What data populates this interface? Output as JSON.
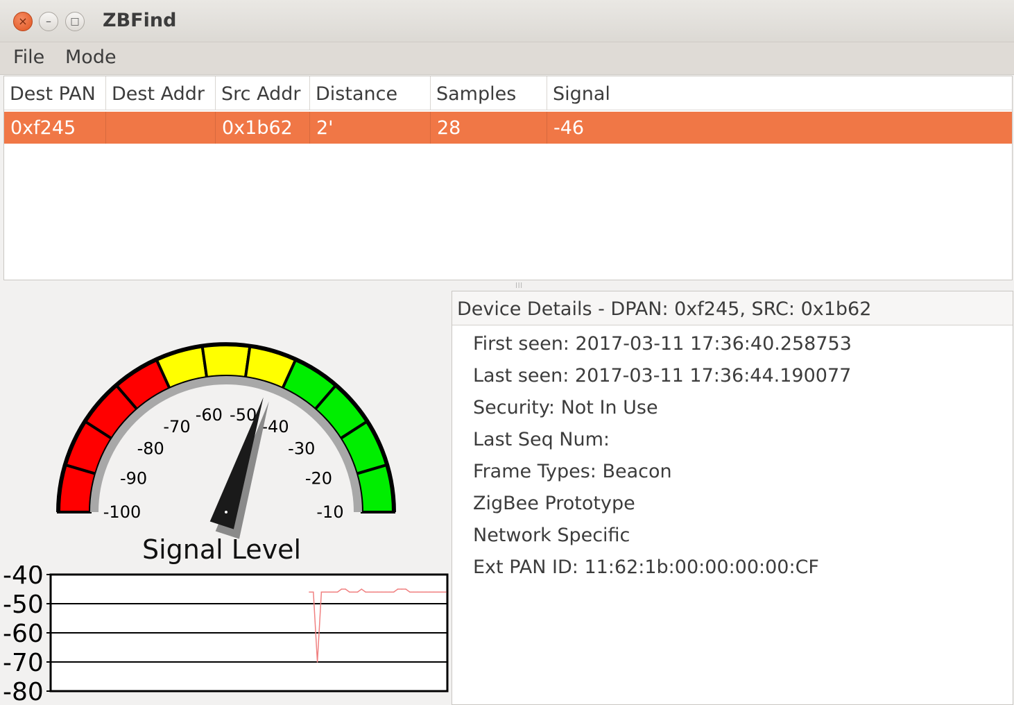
{
  "window": {
    "title": "ZBFind",
    "close_glyph": "×",
    "min_glyph": "–",
    "max_glyph": "□"
  },
  "menu": [
    "File",
    "Mode"
  ],
  "table": {
    "columns": [
      "Dest PAN",
      "Dest Addr",
      "Src Addr",
      "Distance",
      "Samples",
      "Signal"
    ],
    "rows": [
      {
        "dest_pan": "0xf245",
        "dest_addr": "",
        "src_addr": "0x1b62",
        "distance": "2'",
        "samples": "28",
        "signal": "-46"
      }
    ]
  },
  "gauge": {
    "title": "Signal Level",
    "value": -46,
    "min": -100,
    "max": -10,
    "tick_labels": [
      "-100",
      "-90",
      "-80",
      "-70",
      "-60",
      "-50",
      "-40",
      "-30",
      "-20",
      "-10"
    ],
    "colors": {
      "red": "#ff0000",
      "yellow": "#ffff00",
      "green": "#00ee00",
      "needle": "#1a1a1a"
    }
  },
  "chart_data": {
    "type": "line",
    "y_tick_labels": [
      "-40",
      "-50",
      "-60",
      "-70",
      "-80"
    ],
    "ylim": [
      -80,
      -40
    ],
    "grid": true,
    "line_color": "#f08080",
    "series": [
      {
        "values": [
          -46,
          -46,
          -70,
          -46,
          -46,
          -46,
          -46,
          -46,
          -45,
          -45,
          -46,
          -46,
          -46,
          -45,
          -46,
          -46,
          -46,
          -46,
          -46,
          -46,
          -46,
          -46,
          -45,
          -45,
          -45,
          -46,
          -46,
          -46,
          -46,
          -46,
          -46,
          -46,
          -46,
          -46,
          -46
        ]
      }
    ]
  },
  "details": {
    "header": "Device Details - DPAN: 0xf245, SRC: 0x1b62",
    "lines": [
      "First seen: 2017-03-11 17:36:40.258753",
      "Last seen: 2017-03-11 17:36:44.190077",
      "Security: Not In Use",
      "Last Seq Num:",
      "Frame Types: Beacon",
      "ZigBee Prototype",
      "Network Specific",
      "Ext PAN ID: 11:62:1b:00:00:00:00:CF"
    ]
  }
}
